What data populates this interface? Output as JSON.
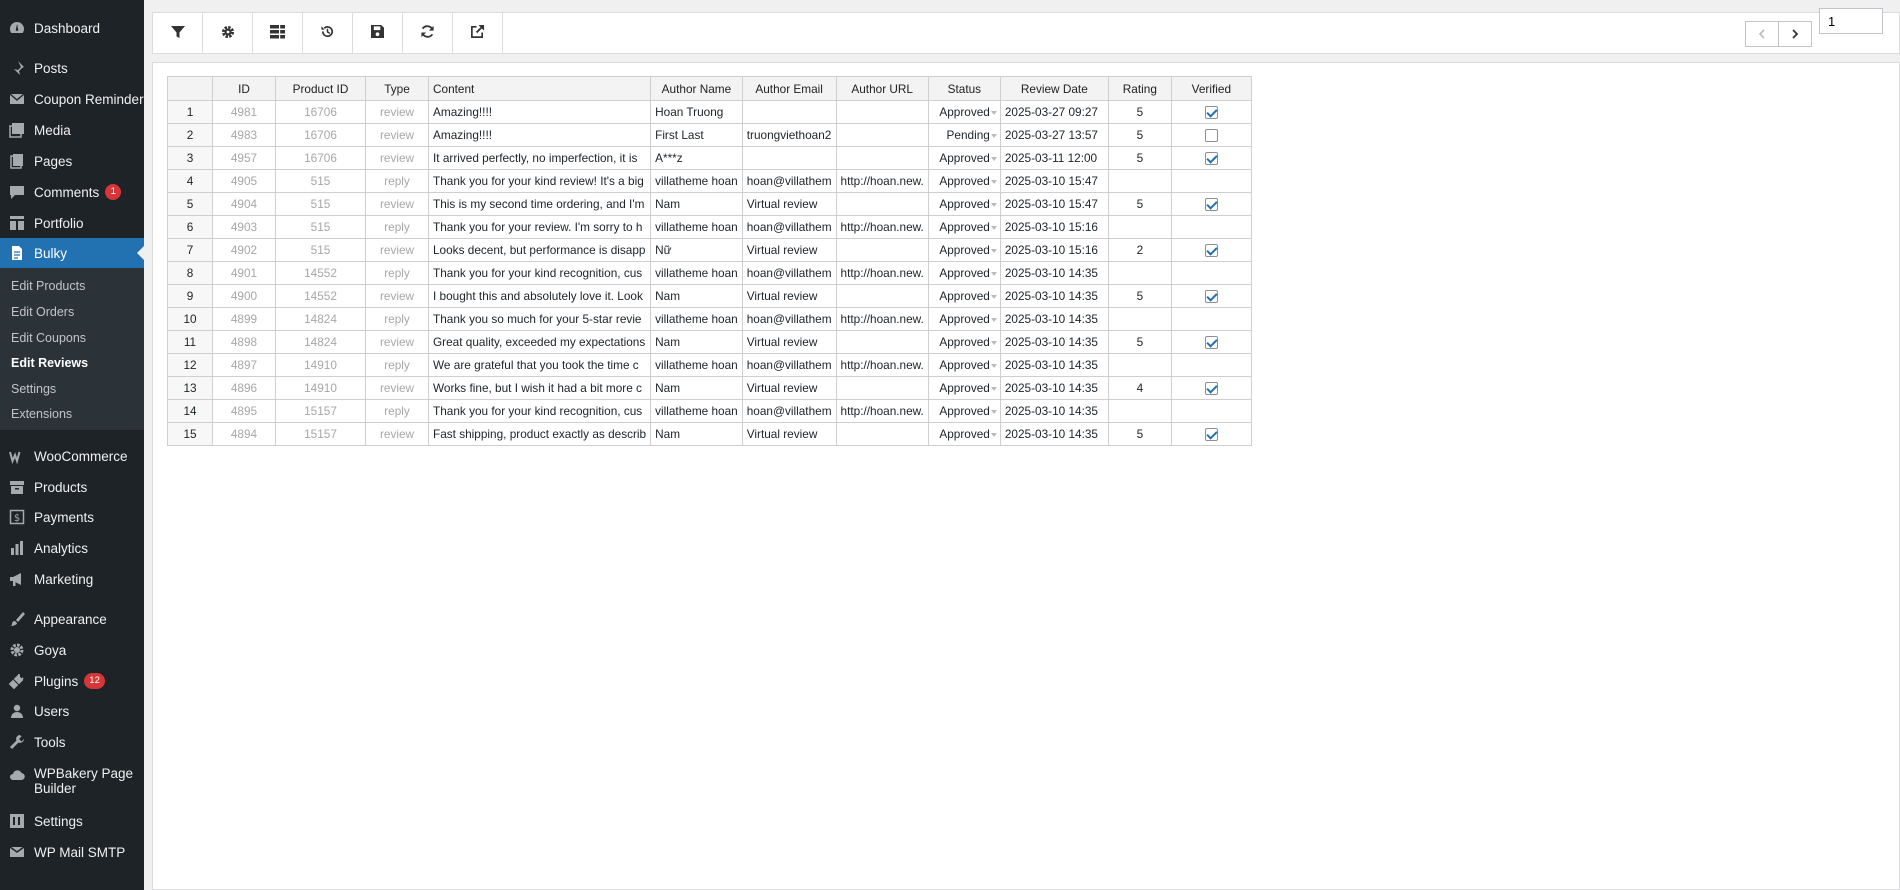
{
  "sidebar": {
    "items": [
      {
        "label": "Dashboard",
        "icon": "dashboard-icon"
      },
      {
        "label": "Posts",
        "icon": "pin-icon"
      },
      {
        "label": "Coupon Reminder",
        "icon": "email-icon"
      },
      {
        "label": "Media",
        "icon": "media-icon"
      },
      {
        "label": "Pages",
        "icon": "pages-icon"
      },
      {
        "label": "Comments",
        "icon": "comment-icon",
        "badge": "1"
      },
      {
        "label": "Portfolio",
        "icon": "portfolio-icon"
      },
      {
        "label": "Bulky",
        "icon": "document-icon"
      },
      {
        "label": "WooCommerce",
        "icon": "woocommerce-icon"
      },
      {
        "label": "Products",
        "icon": "archive-icon"
      },
      {
        "label": "Payments",
        "icon": "dollar-icon"
      },
      {
        "label": "Analytics",
        "icon": "bar-chart-icon"
      },
      {
        "label": "Marketing",
        "icon": "megaphone-icon"
      },
      {
        "label": "Appearance",
        "icon": "paintbrush-icon"
      },
      {
        "label": "Goya",
        "icon": "gear-icon"
      },
      {
        "label": "Plugins",
        "icon": "plugin-icon",
        "badge": "12"
      },
      {
        "label": "Users",
        "icon": "user-icon"
      },
      {
        "label": "Tools",
        "icon": "wrench-icon"
      },
      {
        "label": "WPBakery Page Builder",
        "icon": "cloud-icon"
      },
      {
        "label": "Settings",
        "icon": "settings-icon"
      },
      {
        "label": "WP Mail SMTP",
        "icon": "mail-icon"
      }
    ],
    "submenu": [
      {
        "label": "Edit Products"
      },
      {
        "label": "Edit Orders"
      },
      {
        "label": "Edit Coupons"
      },
      {
        "label": "Edit Reviews"
      },
      {
        "label": "Settings"
      },
      {
        "label": "Extensions"
      }
    ]
  },
  "toolbar": {
    "buttons": [
      "filter-icon",
      "gear-icon",
      "columns-icon",
      "history-icon",
      "save-icon",
      "refresh-icon",
      "external-link-icon"
    ],
    "page_value": "1"
  },
  "table": {
    "columns": [
      "",
      "ID",
      "Product ID",
      "Type",
      "Content",
      "Author Name",
      "Author Email",
      "Author URL",
      "Status",
      "Review Date",
      "Rating",
      "Verified"
    ],
    "rows": [
      {
        "n": "1",
        "id": "4981",
        "pid": "16706",
        "type": "review",
        "content": "Amazing!!!!",
        "name": "Hoan Truong",
        "email": "",
        "url": "",
        "status": "Approved",
        "date": "2025-03-27 09:27",
        "rating": "5",
        "verified": true
      },
      {
        "n": "2",
        "id": "4983",
        "pid": "16706",
        "type": "review",
        "content": "Amazing!!!!",
        "name": "First Last",
        "email": "truongviethoan2",
        "url": "",
        "status": "Pending",
        "date": "2025-03-27 13:57",
        "rating": "5",
        "verified": false
      },
      {
        "n": "3",
        "id": "4957",
        "pid": "16706",
        "type": "review",
        "content": "It arrived perfectly, no imperfection, it is",
        "name": "A***z",
        "email": "",
        "url": "",
        "status": "Approved",
        "date": "2025-03-11 12:00",
        "rating": "5",
        "verified": true
      },
      {
        "n": "4",
        "id": "4905",
        "pid": "515",
        "type": "reply",
        "content": "Thank you for your kind review! It's a big",
        "name": "villatheme hoan",
        "email": "hoan@villathem",
        "url": "http://hoan.new.",
        "status": "Approved",
        "date": "2025-03-10 15:47",
        "rating": "",
        "verified": null
      },
      {
        "n": "5",
        "id": "4904",
        "pid": "515",
        "type": "review",
        "content": "This is my second time ordering, and I'm",
        "name": "Nam",
        "email": "Virtual review",
        "url": "",
        "status": "Approved",
        "date": "2025-03-10 15:47",
        "rating": "5",
        "verified": true
      },
      {
        "n": "6",
        "id": "4903",
        "pid": "515",
        "type": "reply",
        "content": "Thank you for your review. I'm sorry to h",
        "name": "villatheme hoan",
        "email": "hoan@villathem",
        "url": "http://hoan.new.",
        "status": "Approved",
        "date": "2025-03-10 15:16",
        "rating": "",
        "verified": null
      },
      {
        "n": "7",
        "id": "4902",
        "pid": "515",
        "type": "review",
        "content": "Looks decent, but performance is disapp",
        "name": "Nữ",
        "email": "Virtual review",
        "url": "",
        "status": "Approved",
        "date": "2025-03-10 15:16",
        "rating": "2",
        "verified": true
      },
      {
        "n": "8",
        "id": "4901",
        "pid": "14552",
        "type": "reply",
        "content": "Thank you for your kind recognition, cus",
        "name": "villatheme hoan",
        "email": "hoan@villathem",
        "url": "http://hoan.new.",
        "status": "Approved",
        "date": "2025-03-10 14:35",
        "rating": "",
        "verified": null
      },
      {
        "n": "9",
        "id": "4900",
        "pid": "14552",
        "type": "review",
        "content": "I bought this and absolutely love it. Look",
        "name": "Nam",
        "email": "Virtual review",
        "url": "",
        "status": "Approved",
        "date": "2025-03-10 14:35",
        "rating": "5",
        "verified": true
      },
      {
        "n": "10",
        "id": "4899",
        "pid": "14824",
        "type": "reply",
        "content": "Thank you so much for your 5-star revie",
        "name": "villatheme hoan",
        "email": "hoan@villathem",
        "url": "http://hoan.new.",
        "status": "Approved",
        "date": "2025-03-10 14:35",
        "rating": "",
        "verified": null
      },
      {
        "n": "11",
        "id": "4898",
        "pid": "14824",
        "type": "review",
        "content": "Great quality, exceeded my expectations",
        "name": "Nam",
        "email": "Virtual review",
        "url": "",
        "status": "Approved",
        "date": "2025-03-10 14:35",
        "rating": "5",
        "verified": true
      },
      {
        "n": "12",
        "id": "4897",
        "pid": "14910",
        "type": "reply",
        "content": "We are grateful that you took the time c",
        "name": "villatheme hoan",
        "email": "hoan@villathem",
        "url": "http://hoan.new.",
        "status": "Approved",
        "date": "2025-03-10 14:35",
        "rating": "",
        "verified": null
      },
      {
        "n": "13",
        "id": "4896",
        "pid": "14910",
        "type": "review",
        "content": "Works fine, but I wish it had a bit more c",
        "name": "Nam",
        "email": "Virtual review",
        "url": "",
        "status": "Approved",
        "date": "2025-03-10 14:35",
        "rating": "4",
        "verified": true
      },
      {
        "n": "14",
        "id": "4895",
        "pid": "15157",
        "type": "reply",
        "content": "Thank you for your kind recognition, cus",
        "name": "villatheme hoan",
        "email": "hoan@villathem",
        "url": "http://hoan.new.",
        "status": "Approved",
        "date": "2025-03-10 14:35",
        "rating": "",
        "verified": null
      },
      {
        "n": "15",
        "id": "4894",
        "pid": "15157",
        "type": "review",
        "content": "Fast shipping, product exactly as describ",
        "name": "Nam",
        "email": "Virtual review",
        "url": "",
        "status": "Approved",
        "date": "2025-03-10 14:35",
        "rating": "5",
        "verified": true
      }
    ]
  }
}
